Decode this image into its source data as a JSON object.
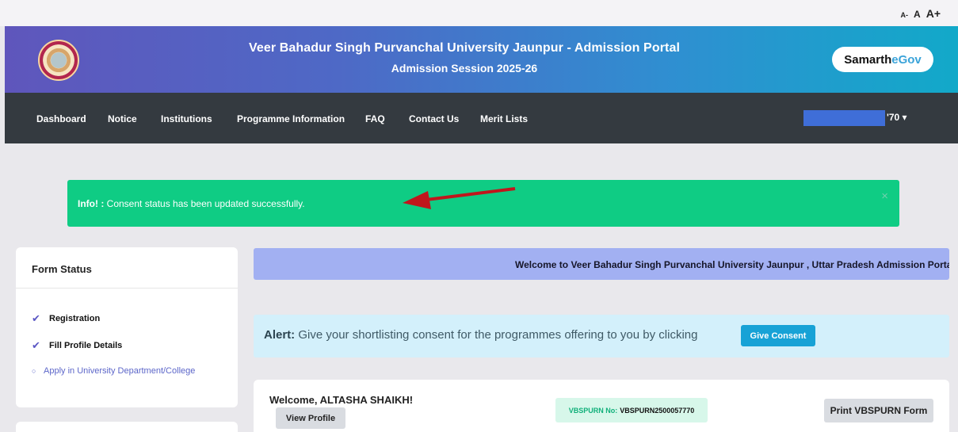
{
  "font_sizer": {
    "small": "A-",
    "normal": "A",
    "large": "A+"
  },
  "header": {
    "title": "Veer Bahadur Singh Purvanchal University Jaunpur - Admission Portal",
    "subtitle": "Admission Session 2025-26",
    "brand_part1": "Samarth",
    "brand_part2": "eGov"
  },
  "nav": {
    "items": [
      "Dashboard",
      "Notice",
      "Institutions",
      "Programme Information",
      "FAQ",
      "Contact Us",
      "Merit Lists"
    ],
    "user_label": "'70 ▾"
  },
  "success_alert": {
    "prefix": "Info! :",
    "message": "Consent status has been updated successfully.",
    "close": "×"
  },
  "form_status": {
    "title": "Form Status",
    "steps": [
      {
        "label": "Registration",
        "done": true
      },
      {
        "label": "Fill Profile Details",
        "done": true
      },
      {
        "label": "Apply in University Department/College",
        "done": false
      }
    ]
  },
  "marquee_text": "Welcome to Veer Bahadur Singh Purvanchal University Jaunpur , Uttar Pradesh Admission Portal",
  "consent_alert": {
    "prefix": "Alert:",
    "message": "Give your shortlisting consent for the programmes offering to you by clicking",
    "button": "Give Consent"
  },
  "welcome": {
    "greeting": "Welcome, ALTASHA SHAIKH!",
    "view_profile": "View Profile",
    "reg_label": "VBSPURN No:",
    "reg_value": "VBSPURN2500057770",
    "print_button": "Print VBSPURN Form"
  },
  "colors": {
    "success": "#0fcc84",
    "info": "#d3f0fb",
    "accent": "#17a2d6",
    "navbar": "#343a40"
  }
}
